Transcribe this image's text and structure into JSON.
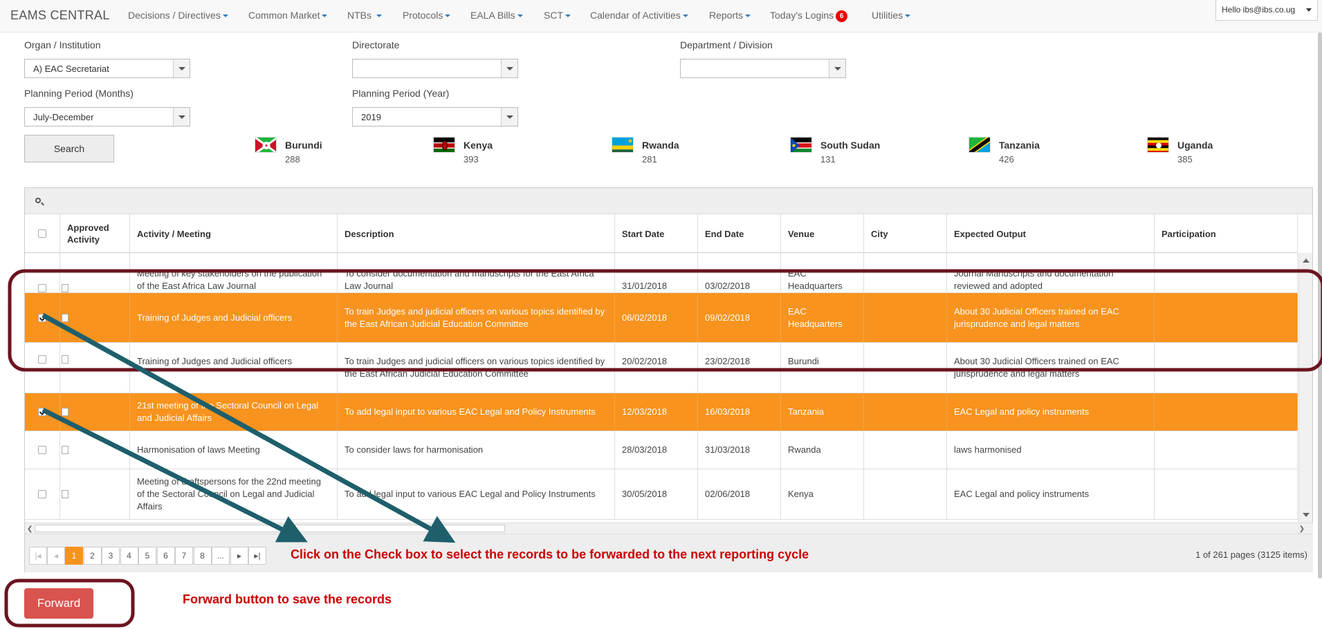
{
  "navbar": {
    "brand": "EAMS CENTRAL",
    "items": [
      {
        "label": "Decisions / Directives",
        "has_caret": true
      },
      {
        "label": "Common Market",
        "has_caret": true
      },
      {
        "label": "NTBs",
        "has_caret": true
      },
      {
        "label": "Protocols",
        "has_caret": true
      },
      {
        "label": "EALA Bills",
        "has_caret": true
      },
      {
        "label": "SCT",
        "has_caret": true
      },
      {
        "label": "Calendar of Activities",
        "has_caret": true
      },
      {
        "label": "Reports",
        "has_caret": true
      },
      {
        "label": "Today's Logins",
        "badge": "6"
      },
      {
        "label": "Utilities",
        "has_caret": true
      }
    ],
    "user": "Hello ibs@ibs.co.ug"
  },
  "filters": {
    "organ_label": "Organ / Institution",
    "organ_value": "A) EAC Secretariat",
    "directorate_label": "Directorate",
    "directorate_value": "",
    "department_label": "Department / Division",
    "department_value": "",
    "period_months_label": "Planning Period (Months)",
    "period_months_value": "July-December",
    "period_year_label": "Planning Period (Year)",
    "period_year_value": "2019",
    "search_label": "Search"
  },
  "countries": [
    {
      "name": "Burundi",
      "count": "288"
    },
    {
      "name": "Kenya",
      "count": "393"
    },
    {
      "name": "Rwanda",
      "count": "281"
    },
    {
      "name": "South Sudan",
      "count": "131"
    },
    {
      "name": "Tanzania",
      "count": "426"
    },
    {
      "name": "Uganda",
      "count": "385"
    }
  ],
  "grid": {
    "columns": [
      "",
      "Approved Activity",
      "Activity / Meeting",
      "Description",
      "Start Date",
      "End Date",
      "Venue",
      "City",
      "Expected Output",
      "Participation"
    ],
    "rows": [
      {
        "selected": false,
        "approved": false,
        "activity": "Meeting of key stakeholders on the publication of the East Africa Law Journal",
        "description": "To consider documentation and manuscripts for the East Africa Law Journal",
        "start": "31/01/2018",
        "end": "03/02/2018",
        "venue": "EAC Headquarters",
        "city": "",
        "output": "Journal Manuscripts and documentation reviewed and adopted",
        "participation": ""
      },
      {
        "selected": true,
        "approved": false,
        "activity": "Training of Judges and Judicial officers",
        "description": "To train Judges and judicial officers on various topics identified by the East African Judicial Education Committee",
        "start": "06/02/2018",
        "end": "09/02/2018",
        "venue": "EAC Headquarters",
        "city": "",
        "output": "About 30 Judicial Officers trained on EAC jurisprudence and legal matters",
        "participation": ""
      },
      {
        "selected": false,
        "approved": false,
        "activity": "Training of Judges and Judicial officers",
        "description": "To train Judges and judicial officers on various topics identified by the East African Judicial Education Committee",
        "start": "20/02/2018",
        "end": "23/02/2018",
        "venue": "Burundi",
        "city": "",
        "output": "About 30 Judicial Officers trained on EAC jurisprudence and legal matters",
        "participation": ""
      },
      {
        "selected": true,
        "approved": false,
        "activity": "21st meeting of the Sectoral Council on Legal and Judicial Affairs",
        "description": "To add legal input to various EAC Legal and Policy Instruments",
        "start": "12/03/2018",
        "end": "16/03/2018",
        "venue": "Tanzania",
        "city": "",
        "output": "EAC Legal and policy instruments",
        "participation": ""
      },
      {
        "selected": false,
        "approved": false,
        "activity": "Harmonisation of laws Meeting",
        "description": "To consider laws for harmonisation",
        "start": "28/03/2018",
        "end": "31/03/2018",
        "venue": "Rwanda",
        "city": "",
        "output": "laws harmonised",
        "participation": ""
      },
      {
        "selected": false,
        "approved": false,
        "activity": "Meeting of draftspersons for the 22nd meeting of the Sectoral Council on Legal and Judicial Affairs",
        "description": "To add legal input to various EAC Legal and Policy Instruments",
        "start": "30/05/2018",
        "end": "02/06/2018",
        "venue": "Kenya",
        "city": "",
        "output": "EAC Legal and policy instruments",
        "participation": ""
      }
    ],
    "pager": {
      "pages": [
        "1",
        "2",
        "3",
        "4",
        "5",
        "6",
        "7",
        "8",
        "..."
      ],
      "current": "1",
      "info": "1 of 261 pages (3125 items)"
    }
  },
  "annotations": {
    "checkbox_instruction": "Click on the Check box to select the records to be forwarded to the next reporting cycle",
    "forward_instruction": "Forward button to save the records",
    "color": "#c00000",
    "arrow_color": "#1e5f6b",
    "ring_color": "#6b1420"
  },
  "actions": {
    "forward_label": "Forward"
  },
  "colors": {
    "selected_row": "#f7931e",
    "forward_button": "#d9534f",
    "accent": "#337ab7"
  }
}
